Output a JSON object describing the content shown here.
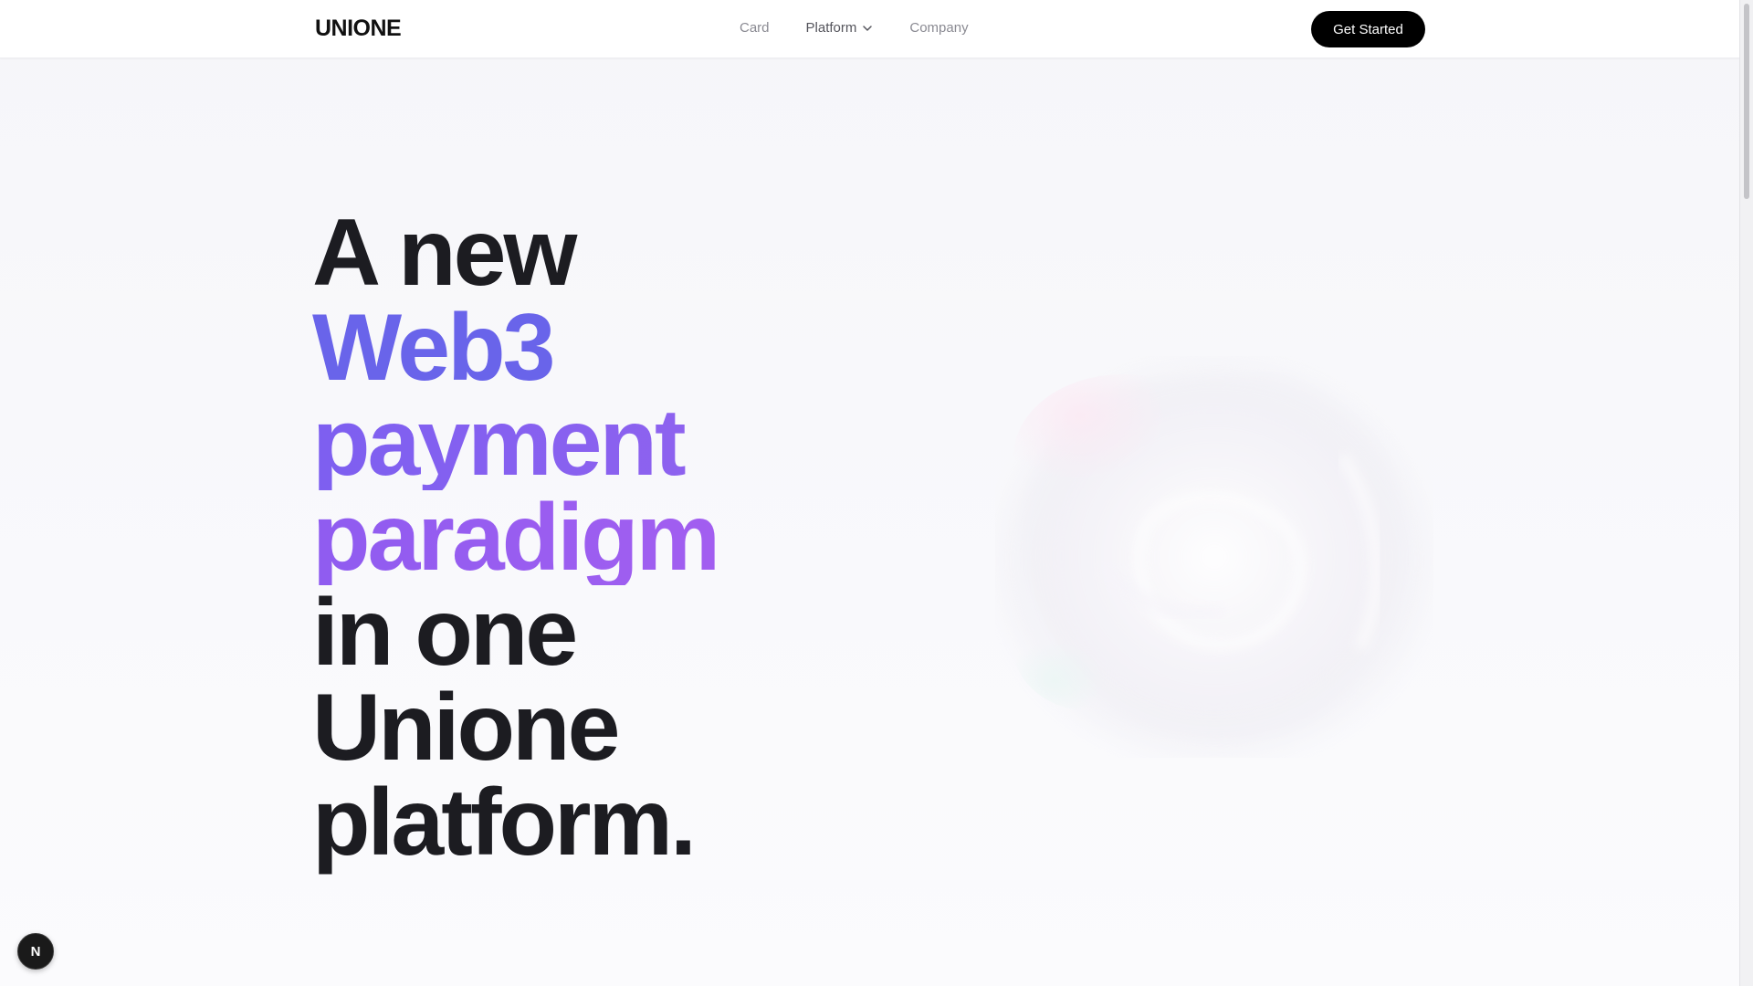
{
  "header": {
    "logo": "UNIONE",
    "nav": [
      {
        "label": "Card"
      },
      {
        "label": "Platform",
        "has_dropdown": true
      },
      {
        "label": "Company"
      }
    ],
    "cta_label": "Get Started"
  },
  "hero": {
    "lines": [
      "A new",
      "Web3",
      "payment",
      "paradigm",
      "in one",
      "Unione",
      "platform."
    ],
    "accent_colors": [
      "#6964ea",
      "#8f62ef",
      "#a25ef0"
    ]
  },
  "badge": {
    "letter": "N"
  },
  "icons": {
    "dropdown": "chevron-down-icon",
    "badge": "nextjs-icon"
  },
  "colors": {
    "cta_bg": "#000000",
    "text_dark": "#1c1c21",
    "nav_text": "#8a8a92"
  }
}
